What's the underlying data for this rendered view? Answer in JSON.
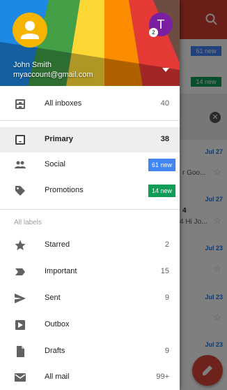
{
  "background": {
    "badges": [
      "61 new",
      "14 new"
    ],
    "snippets": [
      "r Goo...",
      "4",
      "4 Hi Jo..."
    ],
    "dates": [
      "Jul 27",
      "Jul 27",
      "Jul 23",
      "Jul 23",
      "Jul 23"
    ],
    "colors": {
      "app_bar": "#d23f31",
      "fab": "#db4437"
    }
  },
  "account": {
    "name": "John Smith",
    "email": "myaccount@gmail.com",
    "other_avatar_initial": "T",
    "other_avatar_count": "2"
  },
  "nav": {
    "all_inboxes": {
      "label": "All inboxes",
      "count": "40",
      "icon": "all-inboxes-icon"
    },
    "primary": {
      "label": "Primary",
      "count": "38",
      "icon": "inbox-icon"
    },
    "social": {
      "label": "Social",
      "badge": "61 new",
      "icon": "people-icon"
    },
    "promotions": {
      "label": "Promotions",
      "badge": "14 new",
      "icon": "tag-icon"
    },
    "section_label": "All labels",
    "labels": [
      {
        "label": "Starred",
        "count": "2",
        "icon": "star-icon"
      },
      {
        "label": "Important",
        "count": "15",
        "icon": "important-icon"
      },
      {
        "label": "Sent",
        "count": "9",
        "icon": "send-icon"
      },
      {
        "label": "Outbox",
        "count": "",
        "icon": "outbox-icon"
      },
      {
        "label": "Drafts",
        "count": "9",
        "icon": "draft-icon"
      },
      {
        "label": "All mail",
        "count": "99+",
        "icon": "all-mail-icon"
      }
    ]
  },
  "colors": {
    "social_badge": "#4285f4",
    "promotions_badge": "#0f9d58",
    "selected_row": "#eeeeee"
  }
}
